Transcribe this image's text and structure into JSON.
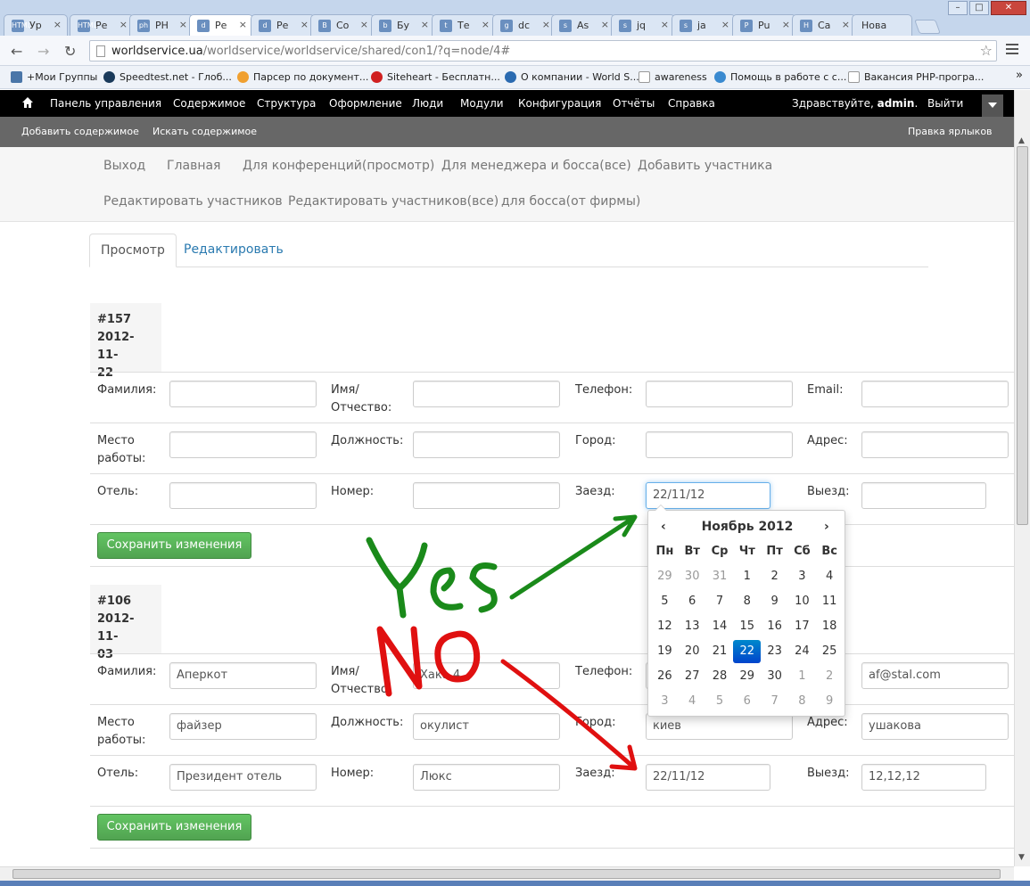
{
  "browser": {
    "tabs": [
      {
        "label": "Ур",
        "icon": "HTML"
      },
      {
        "label": "Ре",
        "icon": "HTML"
      },
      {
        "label": "PH",
        "icon": "ph"
      },
      {
        "label": "Ре",
        "icon": "d"
      },
      {
        "label": "Ре",
        "icon": "d"
      },
      {
        "label": "Со",
        "icon": "B"
      },
      {
        "label": "Бу",
        "icon": "b"
      },
      {
        "label": "Те",
        "icon": "t"
      },
      {
        "label": "dc",
        "icon": "g"
      },
      {
        "label": "As",
        "icon": "s"
      },
      {
        "label": "jq",
        "icon": "s"
      },
      {
        "label": "ja",
        "icon": "s"
      },
      {
        "label": "Pu",
        "icon": "P"
      },
      {
        "label": "Ca",
        "icon": "H"
      },
      {
        "label": "Нова",
        "icon": ""
      }
    ],
    "url_host": "worldservice.ua",
    "url_path": "/worldservice/worldservice/shared/con1/?q=node/4#",
    "bookmarks": [
      "+Мои Группы",
      "Speedtest.net - Глоб...",
      "Парсер по документ...",
      "Siteheart - Бесплатн...",
      "О компании - World S...",
      "awareness",
      "Помощь в работе с с...",
      "Вакансия PHP-програ..."
    ],
    "bookmarks_more": "»"
  },
  "adminbar": {
    "items": [
      "Панель управления",
      "Содержимое",
      "Структура",
      "Оформление",
      "Люди",
      "Модули",
      "Конфигурация",
      "Отчёты",
      "Справка"
    ],
    "greeting_prefix": "Здравствуйте,",
    "greeting_user": "admin",
    "logout": "Выйти"
  },
  "shortcuts": {
    "add": "Добавить содержимое",
    "search": "Искать содержимое",
    "edit": "Правка ярлыков"
  },
  "menu": {
    "items": [
      "Выход",
      "Главная",
      "Для конференций(просмотр)",
      "Для менеджера и босса(все)",
      "Добавить участника",
      "Редактировать участников",
      "Редактировать участников(все)",
      "для босса(от фирмы)"
    ]
  },
  "tabs": {
    "view": "Просмотр",
    "edit": "Редактировать"
  },
  "labels": {
    "surname": "Фамилия:",
    "name_1": "Имя/",
    "name_2": "Отчество:",
    "phone": "Телефон:",
    "email": "Email:",
    "work_1": "Место",
    "work_2": "работы:",
    "position": "Должность:",
    "city": "Город:",
    "address": "Адрес:",
    "hotel": "Отель:",
    "room": "Номер:",
    "checkin": "Заезд:",
    "checkout": "Выезд:"
  },
  "records": [
    {
      "id": "#157",
      "date_1": "2012-11-",
      "date_2": "22",
      "surname": "",
      "name": "",
      "phone": "",
      "email": "",
      "work": "",
      "position": "",
      "city": "",
      "address": "",
      "hotel": "",
      "room": "",
      "checkin": "22/11/12",
      "checkout": "",
      "save": "Сохранить изменения"
    },
    {
      "id": "#106",
      "date_1": "2012-11-",
      "date_2": "03",
      "surname": "Аперкот",
      "name": "Хака 4",
      "phone": "",
      "email": "af@stal.com",
      "work": "файзер",
      "position": "окулист",
      "city": "киев",
      "address": "ушакова",
      "hotel": "Президент отель",
      "room": "Люкс",
      "checkin": "22/11/12",
      "checkout": "12,12,12",
      "save": "Сохранить изменения"
    }
  ],
  "datepicker": {
    "prev": "‹",
    "next": "›",
    "title": "Ноябрь 2012",
    "dow": [
      "Пн",
      "Вт",
      "Ср",
      "Чт",
      "Пт",
      "Сб",
      "Вс"
    ],
    "weeks": [
      [
        {
          "d": "29",
          "m": true
        },
        {
          "d": "30",
          "m": true
        },
        {
          "d": "31",
          "m": true
        },
        {
          "d": "1"
        },
        {
          "d": "2"
        },
        {
          "d": "3"
        },
        {
          "d": "4"
        }
      ],
      [
        {
          "d": "5"
        },
        {
          "d": "6"
        },
        {
          "d": "7"
        },
        {
          "d": "8"
        },
        {
          "d": "9"
        },
        {
          "d": "10"
        },
        {
          "d": "11"
        }
      ],
      [
        {
          "d": "12"
        },
        {
          "d": "13"
        },
        {
          "d": "14"
        },
        {
          "d": "15"
        },
        {
          "d": "16"
        },
        {
          "d": "17"
        },
        {
          "d": "18"
        }
      ],
      [
        {
          "d": "19"
        },
        {
          "d": "20"
        },
        {
          "d": "21"
        },
        {
          "d": "22",
          "s": true
        },
        {
          "d": "23"
        },
        {
          "d": "24"
        },
        {
          "d": "25"
        }
      ],
      [
        {
          "d": "26"
        },
        {
          "d": "27"
        },
        {
          "d": "28"
        },
        {
          "d": "29"
        },
        {
          "d": "30"
        },
        {
          "d": "1",
          "m": true
        },
        {
          "d": "2",
          "m": true
        }
      ],
      [
        {
          "d": "3",
          "m": true
        },
        {
          "d": "4",
          "m": true
        },
        {
          "d": "5",
          "m": true
        },
        {
          "d": "6",
          "m": true
        },
        {
          "d": "7",
          "m": true
        },
        {
          "d": "8",
          "m": true
        },
        {
          "d": "9",
          "m": true
        }
      ]
    ]
  },
  "annotations": {
    "yes": "Yes",
    "no": "NO",
    "yes_color": "#1a8a1a",
    "no_color": "#e01010"
  }
}
